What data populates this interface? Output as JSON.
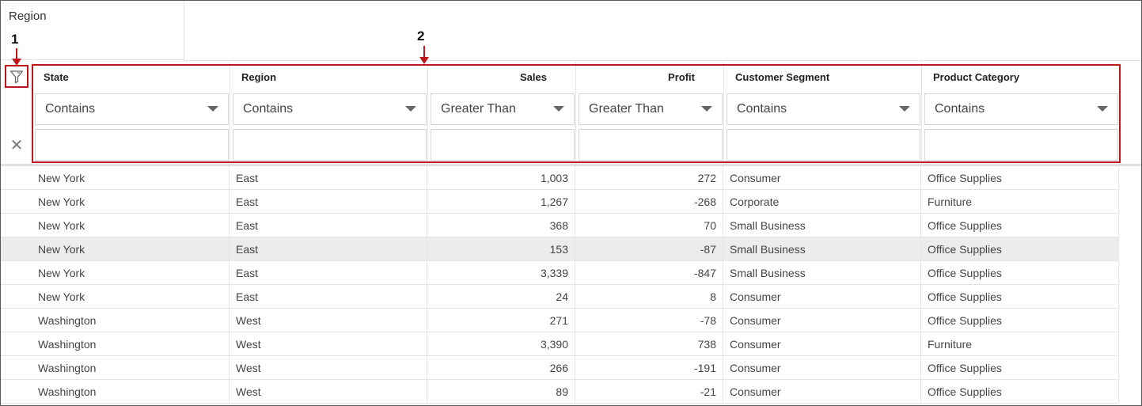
{
  "group_panel": {
    "chip_label": "Region"
  },
  "callouts": {
    "one": "1",
    "two": "2"
  },
  "icons": {
    "filter_toggle": "filter-funnel-icon",
    "clear": "close-icon",
    "dropdown": "chevron-down-icon"
  },
  "accent_color": "#c0151c",
  "columns": [
    {
      "key": "state",
      "label": "State",
      "operator": "Contains",
      "value": ""
    },
    {
      "key": "region",
      "label": "Region",
      "operator": "Contains",
      "value": ""
    },
    {
      "key": "sales",
      "label": "Sales",
      "operator": "Greater Than",
      "value": ""
    },
    {
      "key": "profit",
      "label": "Profit",
      "operator": "Greater Than",
      "value": ""
    },
    {
      "key": "segment",
      "label": "Customer Segment",
      "operator": "Contains",
      "value": ""
    },
    {
      "key": "category",
      "label": "Product Category",
      "operator": "Contains",
      "value": ""
    }
  ],
  "clear_symbol": "✕",
  "rows": [
    [
      "New York",
      "East",
      "1,003",
      "272",
      "Consumer",
      "Office Supplies"
    ],
    [
      "New York",
      "East",
      "1,267",
      "-268",
      "Corporate",
      "Furniture"
    ],
    [
      "New York",
      "East",
      "368",
      "70",
      "Small Business",
      "Office Supplies"
    ],
    [
      "New York",
      "East",
      "153",
      "-87",
      "Small Business",
      "Office Supplies"
    ],
    [
      "New York",
      "East",
      "3,339",
      "-847",
      "Small Business",
      "Office Supplies"
    ],
    [
      "New York",
      "East",
      "24",
      "8",
      "Consumer",
      "Office Supplies"
    ],
    [
      "Washington",
      "West",
      "271",
      "-78",
      "Consumer",
      "Office Supplies"
    ],
    [
      "Washington",
      "West",
      "3,390",
      "738",
      "Consumer",
      "Furniture"
    ],
    [
      "Washington",
      "West",
      "266",
      "-191",
      "Consumer",
      "Office Supplies"
    ],
    [
      "Washington",
      "West",
      "89",
      "-21",
      "Consumer",
      "Office Supplies"
    ]
  ],
  "highlighted_row": 3
}
